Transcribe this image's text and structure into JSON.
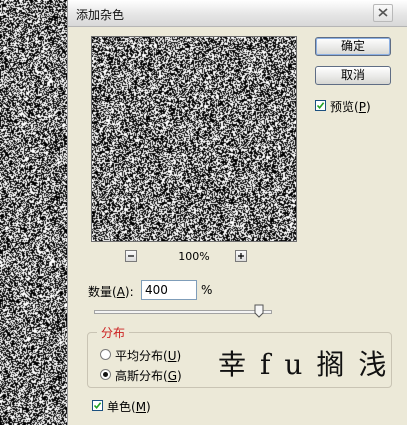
{
  "dialog": {
    "title": "添加杂色"
  },
  "buttons": {
    "ok": "确定",
    "cancel": "取消"
  },
  "preview_option": {
    "label": "预览(",
    "key": "P",
    "suffix": ")",
    "checked": true
  },
  "zoom": {
    "value": "100%"
  },
  "amount": {
    "label": "数量(",
    "key": "A",
    "suffix": "):",
    "value": "400",
    "unit": "%",
    "slider_fraction": 0.95
  },
  "distribution": {
    "title": "分布",
    "uniform": {
      "label": "平均分布(",
      "key": "U",
      "suffix": ")",
      "selected": false
    },
    "gaussian": {
      "label": "高斯分布(",
      "key": "G",
      "suffix": ")",
      "selected": true
    }
  },
  "monochromatic": {
    "label": "单色(",
    "key": "M",
    "suffix": ")",
    "checked": true
  },
  "watermark": {
    "text": "幸fu搁浅"
  },
  "colors": {
    "dialog_bg": "#ece9d8",
    "group_title": "#cc2222"
  }
}
